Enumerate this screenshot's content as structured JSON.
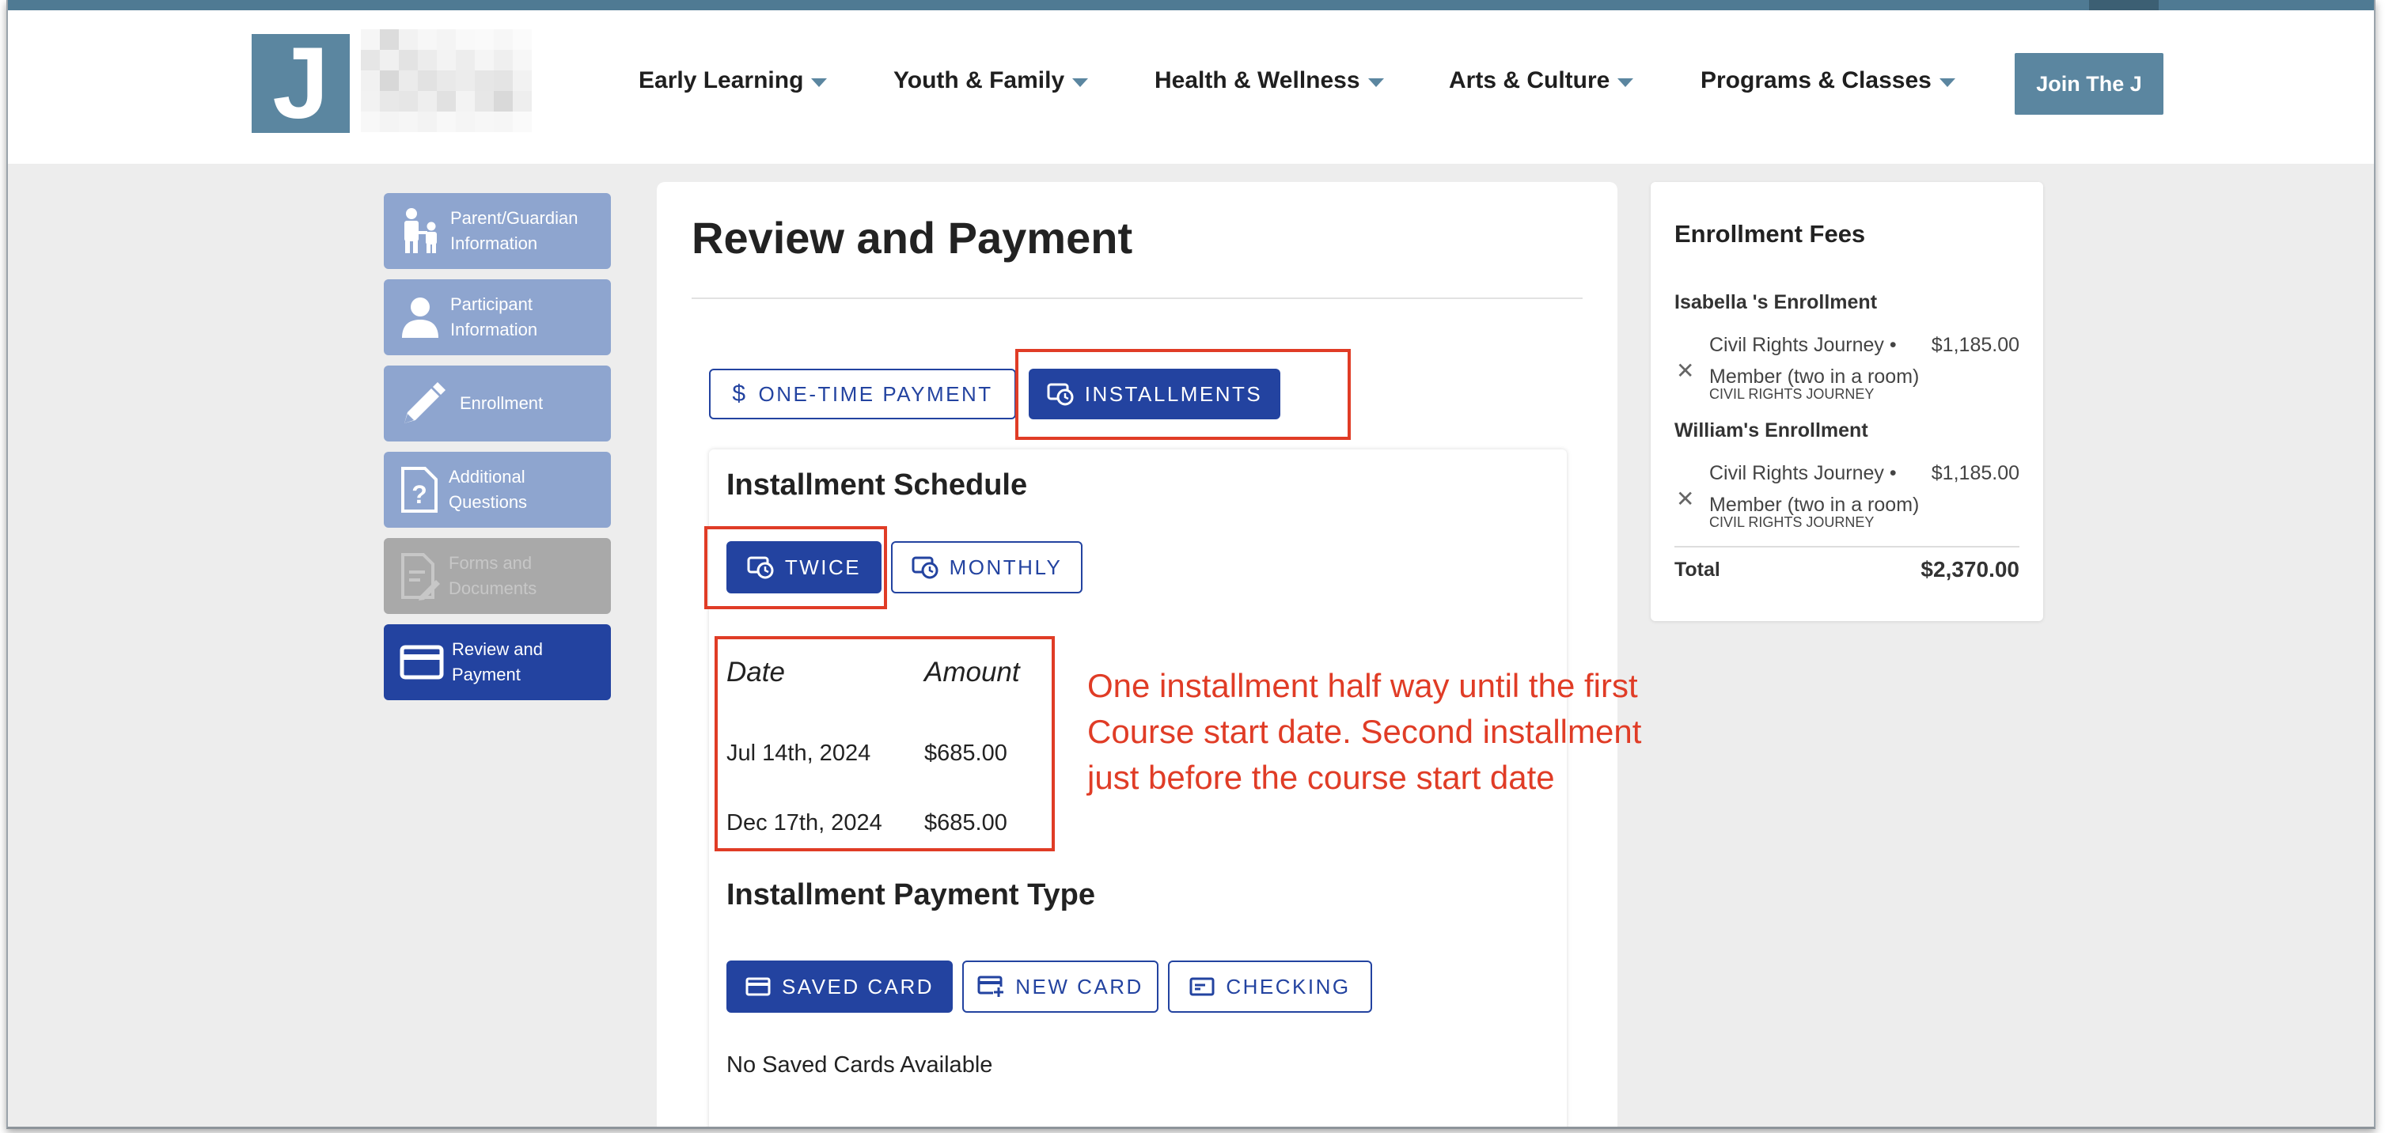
{
  "header": {
    "logo_letter": "J",
    "nav": [
      {
        "label": "Early Learning"
      },
      {
        "label": "Youth & Family"
      },
      {
        "label": "Health & Wellness"
      },
      {
        "label": "Arts & Culture"
      },
      {
        "label": "Programs & Classes"
      }
    ],
    "join_label": "Join The J"
  },
  "steps": [
    {
      "line1": "Parent/Guardian",
      "line2": "Information",
      "icon": "parent-child-icon",
      "state": "done"
    },
    {
      "line1": "Participant",
      "line2": "Information",
      "icon": "person-icon",
      "state": "done"
    },
    {
      "line1": "Enrollment",
      "line2": "",
      "icon": "pencil-icon",
      "state": "done"
    },
    {
      "line1": "Additional",
      "line2": "Questions",
      "icon": "question-doc-icon",
      "state": "done"
    },
    {
      "line1": "Forms and",
      "line2": "Documents",
      "icon": "doc-edit-icon",
      "state": "disabled"
    },
    {
      "line1": "Review and",
      "line2": "Payment",
      "icon": "credit-card-icon",
      "state": "active"
    }
  ],
  "main": {
    "title": "Review and Payment",
    "payment_modes": {
      "one_time": "ONE-TIME PAYMENT",
      "installments": "INSTALLMENTS",
      "selected": "installments"
    },
    "schedule": {
      "heading": "Installment Schedule",
      "options": {
        "twice": "TWICE",
        "monthly": "MONTHLY",
        "selected": "twice"
      },
      "col_date": "Date",
      "col_amount": "Amount",
      "rows": [
        {
          "date": "Jul 14th, 2024",
          "amount": "$685.00"
        },
        {
          "date": "Dec 17th, 2024",
          "amount": "$685.00"
        }
      ]
    },
    "payment_type": {
      "heading": "Installment Payment Type",
      "saved": "SAVED CARD",
      "new": "NEW CARD",
      "checking": "CHECKING",
      "selected": "saved",
      "empty_msg": "No Saved Cards Available"
    }
  },
  "annotation": {
    "line1": "One installment half way until the first",
    "line2": "Course start date. Second installment",
    "line3": "just before the course start date",
    "color": "#e03c26"
  },
  "fees": {
    "title": "Enrollment Fees",
    "groups": [
      {
        "name": "Isabella 's Enrollment",
        "item_line1": "Civil Rights Journey •",
        "item_line2": "Member (two in a room)",
        "sub": "CIVIL RIGHTS JOURNEY",
        "price": "$1,185.00"
      },
      {
        "name": "William's Enrollment",
        "item_line1": "Civil Rights Journey •",
        "item_line2": "Member (two in a room)",
        "sub": "CIVIL RIGHTS JOURNEY",
        "price": "$1,185.00"
      }
    ],
    "total_label": "Total",
    "total_value": "$2,370.00"
  },
  "colors": {
    "brand": "#5b86a0",
    "primary": "#2343a0",
    "step_done": "#8ea5cf",
    "annotation": "#e03c26"
  }
}
